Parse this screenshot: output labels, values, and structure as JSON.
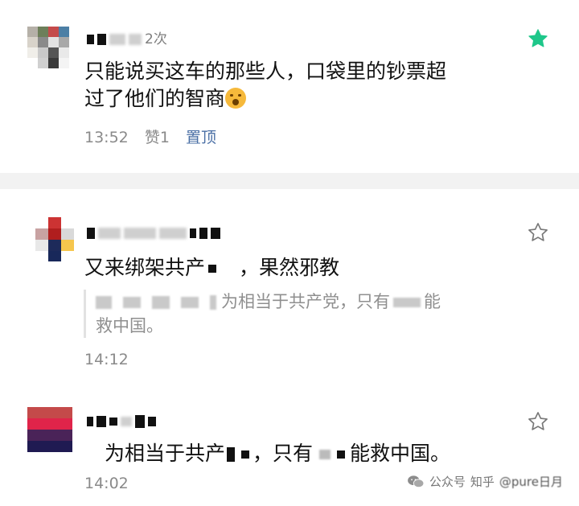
{
  "comments": [
    {
      "nick_suffix": "2次",
      "text_line1": "只能说买这车的那些人，口袋里的钞票超",
      "text_line2": "过了他们的智商",
      "emoji_icon": "yawning-face-icon",
      "time": "13:52",
      "likes": "赞1",
      "pinned": "置顶",
      "starred": true,
      "star_color": "#1ec78a"
    },
    {
      "text_before": "又来绑架共产",
      "text_mid": "，果然邪教",
      "quote_line1": "为相当于共产党，只有",
      "quote_line1_end": "能",
      "quote_line2": "救中国。",
      "time": "14:12",
      "starred": false
    },
    {
      "text_part1": "为相当于共产",
      "text_part2": "，只有",
      "text_part3": "能救中国。",
      "time": "14:02",
      "starred": false
    }
  ],
  "watermark": {
    "prefix": "公众号",
    "zhihu": "知乎",
    "suffix": "@pure日月",
    "icon": "wechat-icon"
  },
  "colors": {
    "accent_green": "#1ec78a",
    "pin_blue": "#4a6fa5"
  }
}
